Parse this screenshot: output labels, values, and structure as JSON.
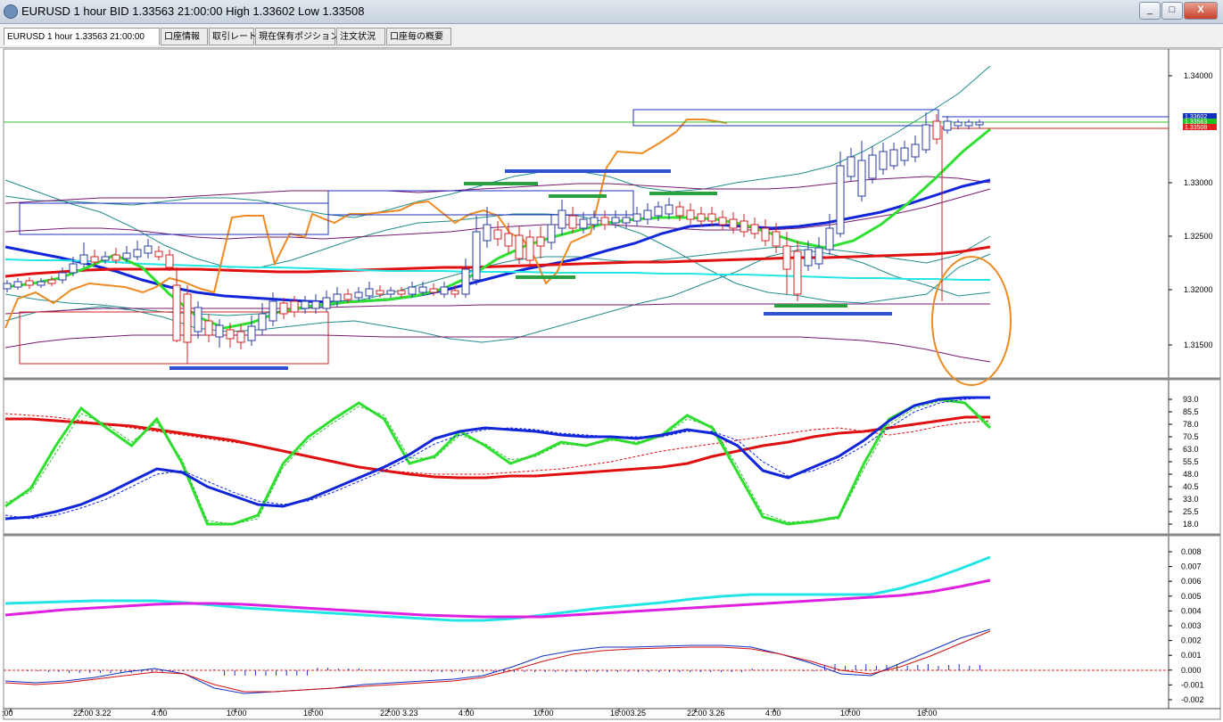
{
  "window": {
    "title": "EURUSD 1 hour BID 1.33563 21:00:00 High 1.33602 Low 1.33508",
    "controls": [
      "_",
      "□",
      "X"
    ]
  },
  "tabs": [
    {
      "label": "EURUSD 1 hour 1.33563 21:00:00",
      "active": true
    },
    {
      "label": "口座情報",
      "active": false
    },
    {
      "label": "取引レート",
      "active": false
    },
    {
      "label": "現在保有ポジション",
      "active": false
    },
    {
      "label": "注文状況",
      "active": false
    },
    {
      "label": "口座毎の概要",
      "active": false
    }
  ],
  "price_axis": {
    "labels": [
      "1.34000",
      "1.33000",
      "1.32500",
      "1.32000",
      "1.31500"
    ],
    "tags": [
      "1.33602",
      "1.33563",
      "1.33508"
    ]
  },
  "stoch_axis": {
    "labels": [
      "93.0",
      "85.5",
      "78.0",
      "70.5",
      "63.0",
      "55.5",
      "48.0",
      "40.5",
      "33.0",
      "25.5",
      "18.0"
    ]
  },
  "macd_axis": {
    "labels": [
      "0.008",
      "0.007",
      "0.006",
      "0.005",
      "0.004",
      "0.003",
      "0.002",
      "0.001",
      "0.000",
      "-0.001",
      "-0.002"
    ]
  },
  "time_axis": {
    "labels": [
      ":00",
      "22:00  3.22",
      "4:00",
      "10:00",
      "16:00",
      "22:00  3.23",
      "4:00",
      "10:00",
      "16:003.25",
      "22:00  3.26",
      "4:00",
      "10:00",
      "16:00"
    ]
  },
  "colors": {
    "bull_candle": "#2a3aa8",
    "bear_candle": "#d42020",
    "ma_blue": "#1026d8",
    "ma_red": "#e01010",
    "ma_green": "#30e030",
    "ma_cyan": "#22e6e6",
    "magenta": "#e020e0",
    "orange": "#ee8a22",
    "bollinger": "#218c8c",
    "purple": "#7a1870"
  }
}
